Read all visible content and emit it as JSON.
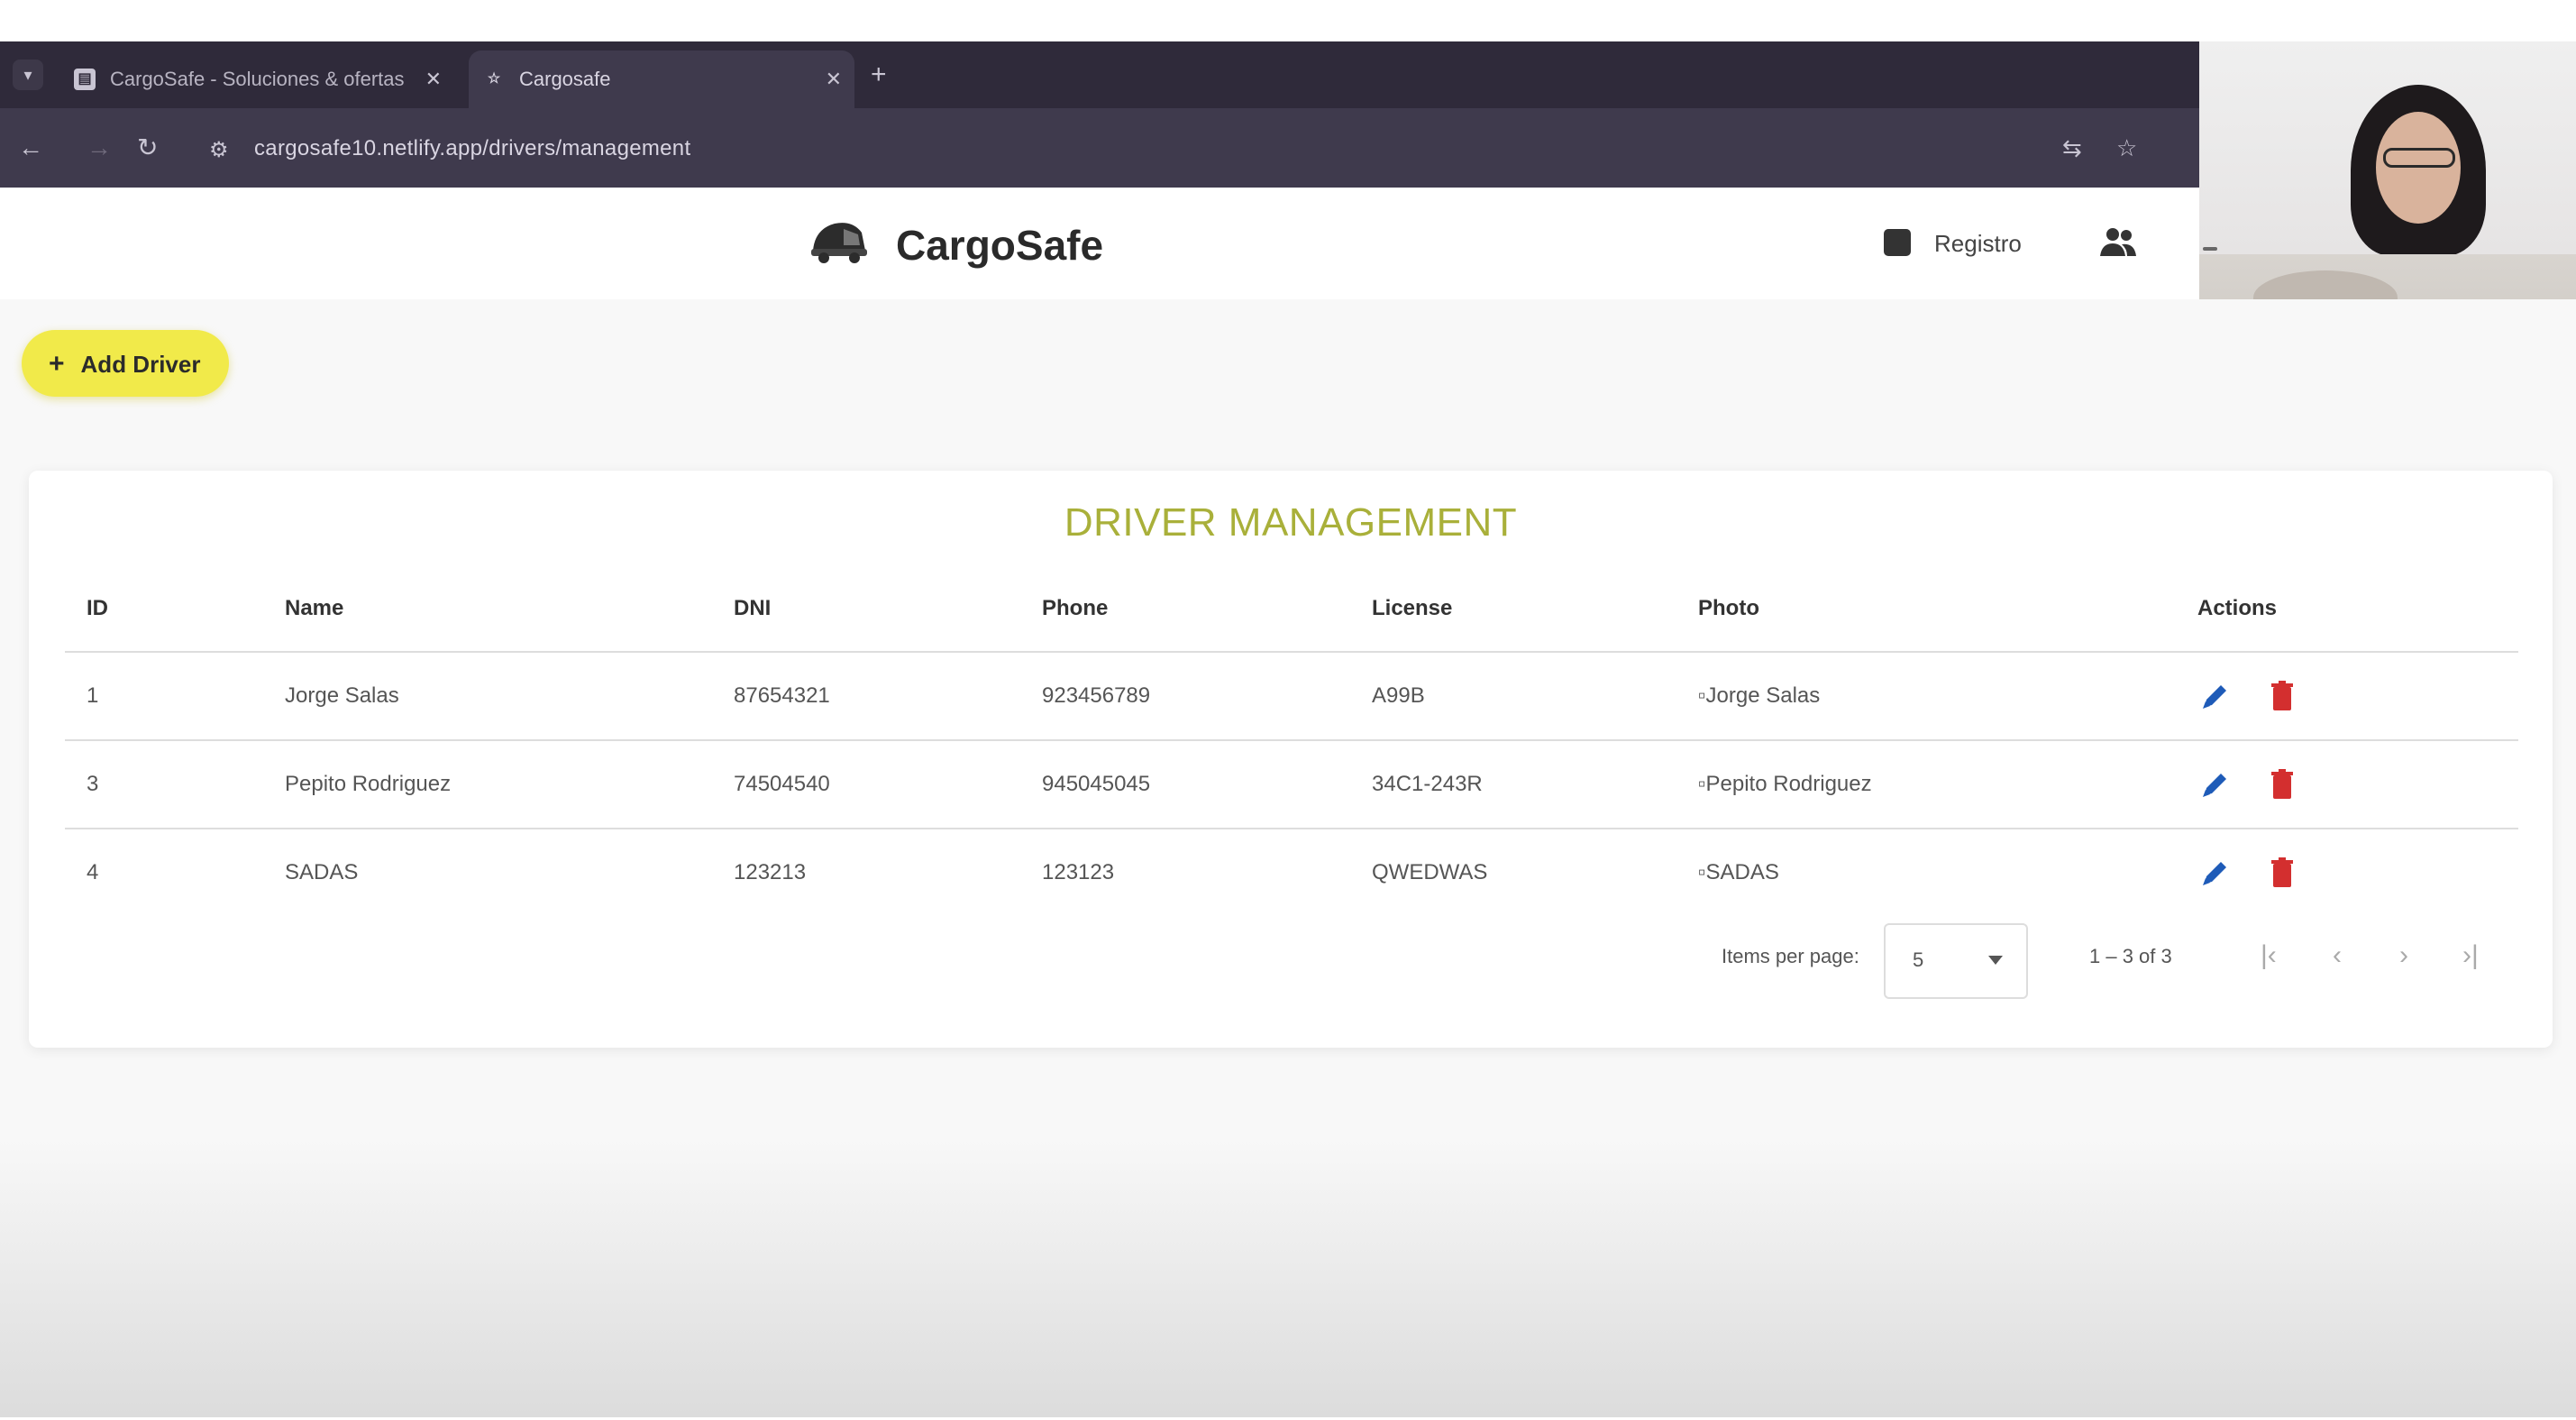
{
  "browser": {
    "tabs": [
      {
        "title": "CargoSafe - Soluciones & ofertas",
        "icon": "page-icon",
        "active": false
      },
      {
        "title": "Cargosafe",
        "icon": "app-icon",
        "active": true
      }
    ],
    "new_tab_label": "+",
    "url": "cargosafe10.netlify.app/drivers/management"
  },
  "video_tiles": [
    {
      "participant": "participant-1",
      "name_tag": ""
    },
    {
      "participant": "participant-2",
      "name_tag": ""
    }
  ],
  "header": {
    "brand": "CargoSafe",
    "nav_registro": "Registro",
    "icons": {
      "logo": "truck-logo-icon",
      "registro": "clipboard-icon",
      "users": "people-icon"
    }
  },
  "actions": {
    "add_driver_plus": "+",
    "add_driver": "Add Driver"
  },
  "driver_management": {
    "title": "DRIVER MANAGEMENT",
    "columns": [
      "ID",
      "Name",
      "DNI",
      "Phone",
      "License",
      "Photo",
      "Actions"
    ],
    "rows": [
      {
        "id": "1",
        "name": "Jorge Salas",
        "dni": "87654321",
        "phone": "923456789",
        "license": "A99B",
        "photo_alt": "Jorge Salas"
      },
      {
        "id": "3",
        "name": "Pepito Rodriguez",
        "dni": "74504540",
        "phone": "945045045",
        "license": "34C1-243R",
        "photo_alt": "Pepito Rodriguez"
      },
      {
        "id": "4",
        "name": "SADAS",
        "dni": "123213",
        "phone": "123123",
        "license": "QWEDWAS",
        "photo_alt": "SADAS"
      }
    ],
    "row_action_icons": [
      "edit-pencil-icon",
      "delete-trash-icon"
    ],
    "accent_color": "#a9b03a"
  },
  "pagination": {
    "items_per_page_label": "Items per page:",
    "items_per_page_value": "5",
    "range": "1 – 3 of 3"
  },
  "colors": {
    "primary_yellow": "#f1ea4a",
    "edit_blue": "#1e5bb8",
    "delete_red": "#d32f2f"
  }
}
